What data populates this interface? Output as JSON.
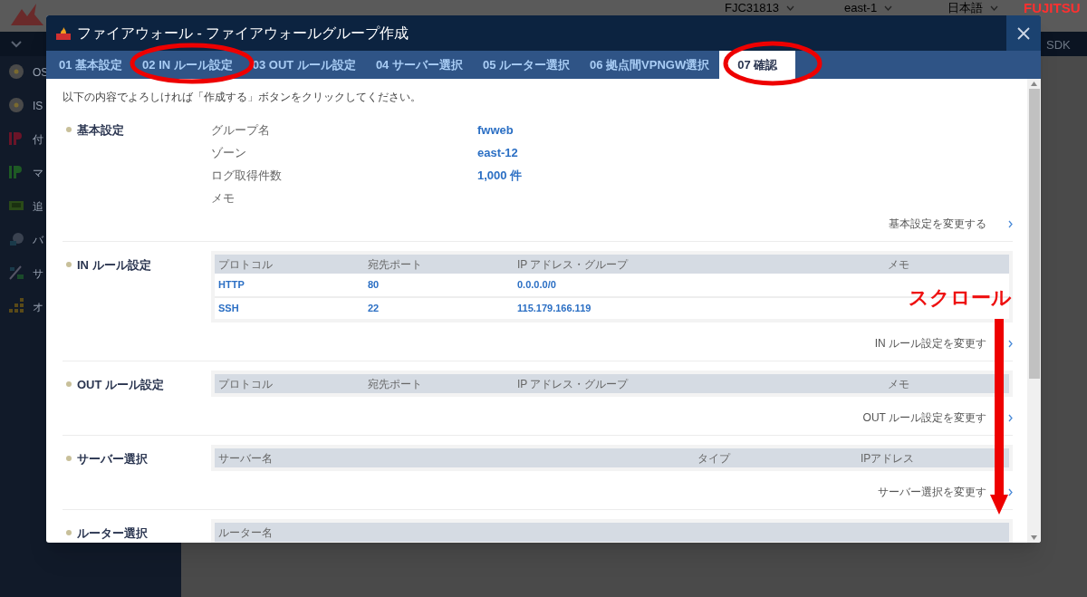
{
  "header": {
    "account": "FJC31813",
    "region": "east-1",
    "language": "日本語",
    "logo": "FUJITSU"
  },
  "nav": {
    "item": "SDK"
  },
  "sidebar": {
    "items": [
      {
        "label": "OS",
        "kind": "disc"
      },
      {
        "label": "IS",
        "kind": "disc"
      },
      {
        "label": "付",
        "kind": "ip-red"
      },
      {
        "label": "マ",
        "kind": "ip-green"
      },
      {
        "label": "追",
        "kind": "card"
      },
      {
        "label": "バ",
        "kind": "clock"
      },
      {
        "label": "サ",
        "kind": "slash"
      },
      {
        "label": "オ",
        "kind": "blocks"
      }
    ]
  },
  "dialog": {
    "title": "ファイアウォール - ファイアウォールグループ作成",
    "tabs": [
      {
        "label": "01 基本設定",
        "selected": false
      },
      {
        "label": "02 IN ルール設定",
        "selected": false
      },
      {
        "label": "03 OUT ルール設定",
        "selected": false
      },
      {
        "label": "04 サーバー選択",
        "selected": false
      },
      {
        "label": "05 ルーター選択",
        "selected": false
      },
      {
        "label": "06 拠点間VPNGW選択",
        "selected": false
      },
      {
        "label": "07 確認",
        "selected": true
      }
    ],
    "intro": "以下の内容でよろしければ「作成する」ボタンをクリックしてください。",
    "sections": [
      {
        "kind": "fields",
        "title": "基本設定",
        "fields": [
          {
            "label": "グループ名",
            "value": "fwweb"
          },
          {
            "label": "ゾーン",
            "value": "east-12"
          },
          {
            "label": "ログ取得件数",
            "value": "1,000 件"
          },
          {
            "label": "メモ"
          }
        ],
        "link": "基本設定を変更する"
      },
      {
        "kind": "table",
        "title": "IN ルール設定",
        "columns": [
          "プロトコル",
          "宛先ポート",
          "IP アドレス・グループ",
          "メモ"
        ],
        "rows": [
          [
            "HTTP",
            "80",
            "0.0.0.0/0"
          ],
          [
            "SSH",
            "22",
            "115.179.166.119"
          ]
        ],
        "link": "IN ルール設定を変更す"
      },
      {
        "kind": "table",
        "title": "OUT ルール設定",
        "columns": [
          "プロトコル",
          "宛先ポート",
          "IP アドレス・グループ",
          "メモ"
        ],
        "link": "OUT ルール設定を変更す"
      },
      {
        "kind": "table",
        "title": "サーバー選択",
        "columns": [
          "サーバー名",
          "タイプ",
          "IPアドレス"
        ],
        "link": "サーバー選択を変更す"
      },
      {
        "kind": "table",
        "title": "ルーター選択",
        "columns": [
          "ルーター名"
        ]
      }
    ]
  },
  "annotations": {
    "scroll_label": "スクロール"
  }
}
